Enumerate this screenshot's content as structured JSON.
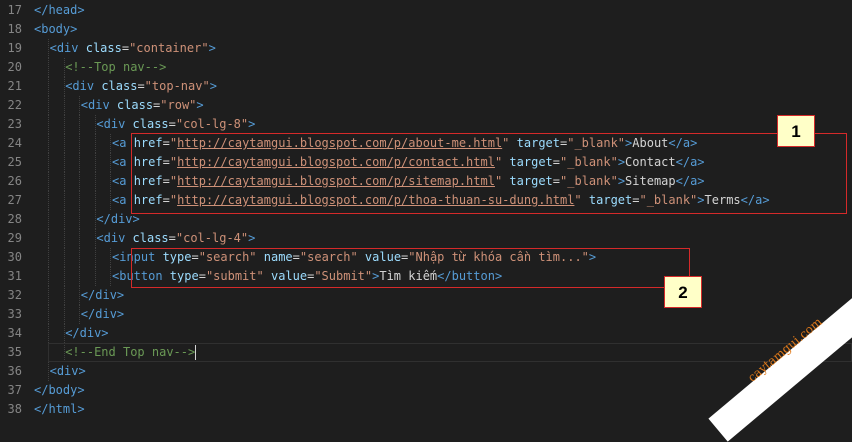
{
  "editor": {
    "lines": [
      {
        "n": "17",
        "indent": 0,
        "tokens": [
          {
            "c": "tag",
            "t": "</head>"
          }
        ]
      },
      {
        "n": "18",
        "indent": 0,
        "tokens": [
          {
            "c": "tag",
            "t": "<body>"
          }
        ]
      },
      {
        "n": "19",
        "indent": 1,
        "tokens": [
          {
            "c": "tag",
            "t": "<div "
          },
          {
            "c": "attr",
            "t": "class"
          },
          {
            "c": "txt",
            "t": "="
          },
          {
            "c": "str",
            "t": "\"container\""
          },
          {
            "c": "tag",
            "t": ">"
          }
        ]
      },
      {
        "n": "20",
        "indent": 2,
        "tokens": [
          {
            "c": "comment",
            "t": "<!--Top nav-->"
          }
        ]
      },
      {
        "n": "21",
        "indent": 2,
        "tokens": [
          {
            "c": "tag",
            "t": "<div "
          },
          {
            "c": "attr",
            "t": "class"
          },
          {
            "c": "txt",
            "t": "="
          },
          {
            "c": "str",
            "t": "\"top-nav\""
          },
          {
            "c": "tag",
            "t": ">"
          }
        ]
      },
      {
        "n": "22",
        "indent": 3,
        "tokens": [
          {
            "c": "tag",
            "t": "<div "
          },
          {
            "c": "attr",
            "t": "class"
          },
          {
            "c": "txt",
            "t": "="
          },
          {
            "c": "str",
            "t": "\"row\""
          },
          {
            "c": "tag",
            "t": ">"
          }
        ]
      },
      {
        "n": "23",
        "indent": 4,
        "tokens": [
          {
            "c": "tag",
            "t": "<div "
          },
          {
            "c": "attr",
            "t": "class"
          },
          {
            "c": "txt",
            "t": "="
          },
          {
            "c": "str",
            "t": "\"col-lg-8\""
          },
          {
            "c": "tag",
            "t": ">"
          }
        ]
      },
      {
        "n": "24",
        "indent": 5,
        "tokens": [
          {
            "c": "tag",
            "t": "<a "
          },
          {
            "c": "attr",
            "t": "href"
          },
          {
            "c": "txt",
            "t": "="
          },
          {
            "c": "str",
            "t": "\""
          },
          {
            "c": "link",
            "t": "http://caytamgui.blogspot.com/p/about-me.html"
          },
          {
            "c": "str",
            "t": "\""
          },
          {
            "c": "txt",
            "t": " "
          },
          {
            "c": "attr",
            "t": "target"
          },
          {
            "c": "txt",
            "t": "="
          },
          {
            "c": "str",
            "t": "\"_blank\""
          },
          {
            "c": "tag",
            "t": ">"
          },
          {
            "c": "txt",
            "t": "About"
          },
          {
            "c": "tag",
            "t": "</a>"
          }
        ]
      },
      {
        "n": "25",
        "indent": 5,
        "tokens": [
          {
            "c": "tag",
            "t": "<a "
          },
          {
            "c": "attr",
            "t": "href"
          },
          {
            "c": "txt",
            "t": "="
          },
          {
            "c": "str",
            "t": "\""
          },
          {
            "c": "link",
            "t": "http://caytamgui.blogspot.com/p/contact.html"
          },
          {
            "c": "str",
            "t": "\""
          },
          {
            "c": "txt",
            "t": " "
          },
          {
            "c": "attr",
            "t": "target"
          },
          {
            "c": "txt",
            "t": "="
          },
          {
            "c": "str",
            "t": "\"_blank\""
          },
          {
            "c": "tag",
            "t": ">"
          },
          {
            "c": "txt",
            "t": "Contact"
          },
          {
            "c": "tag",
            "t": "</a>"
          }
        ]
      },
      {
        "n": "26",
        "indent": 5,
        "tokens": [
          {
            "c": "tag",
            "t": "<a "
          },
          {
            "c": "attr",
            "t": "href"
          },
          {
            "c": "txt",
            "t": "="
          },
          {
            "c": "str",
            "t": "\""
          },
          {
            "c": "link",
            "t": "http://caytamgui.blogspot.com/p/sitemap.html"
          },
          {
            "c": "str",
            "t": "\""
          },
          {
            "c": "txt",
            "t": " "
          },
          {
            "c": "attr",
            "t": "target"
          },
          {
            "c": "txt",
            "t": "="
          },
          {
            "c": "str",
            "t": "\"_blank\""
          },
          {
            "c": "tag",
            "t": ">"
          },
          {
            "c": "txt",
            "t": "Sitemap"
          },
          {
            "c": "tag",
            "t": "</a>"
          }
        ]
      },
      {
        "n": "27",
        "indent": 5,
        "tokens": [
          {
            "c": "tag",
            "t": "<a "
          },
          {
            "c": "attr",
            "t": "href"
          },
          {
            "c": "txt",
            "t": "="
          },
          {
            "c": "str",
            "t": "\""
          },
          {
            "c": "link",
            "t": "http://caytamgui.blogspot.com/p/thoa-thuan-su-dung.html"
          },
          {
            "c": "str",
            "t": "\""
          },
          {
            "c": "txt",
            "t": " "
          },
          {
            "c": "attr",
            "t": "target"
          },
          {
            "c": "txt",
            "t": "="
          },
          {
            "c": "str",
            "t": "\"_blank\""
          },
          {
            "c": "tag",
            "t": ">"
          },
          {
            "c": "txt",
            "t": "Terms"
          },
          {
            "c": "tag",
            "t": "</a>"
          }
        ]
      },
      {
        "n": "28",
        "indent": 4,
        "tokens": [
          {
            "c": "tag",
            "t": "</div>"
          }
        ]
      },
      {
        "n": "29",
        "indent": 4,
        "tokens": [
          {
            "c": "tag",
            "t": "<div "
          },
          {
            "c": "attr",
            "t": "class"
          },
          {
            "c": "txt",
            "t": "="
          },
          {
            "c": "str",
            "t": "\"col-lg-4\""
          },
          {
            "c": "tag",
            "t": ">"
          }
        ]
      },
      {
        "n": "30",
        "indent": 5,
        "tokens": [
          {
            "c": "tag",
            "t": "<input "
          },
          {
            "c": "attr",
            "t": "type"
          },
          {
            "c": "txt",
            "t": "="
          },
          {
            "c": "str",
            "t": "\"search\""
          },
          {
            "c": "txt",
            "t": " "
          },
          {
            "c": "attr",
            "t": "name"
          },
          {
            "c": "txt",
            "t": "="
          },
          {
            "c": "str",
            "t": "\"search\""
          },
          {
            "c": "txt",
            "t": " "
          },
          {
            "c": "attr",
            "t": "value"
          },
          {
            "c": "txt",
            "t": "="
          },
          {
            "c": "str",
            "t": "\"Nhập từ khóa cần tìm...\""
          },
          {
            "c": "tag",
            "t": ">"
          }
        ]
      },
      {
        "n": "31",
        "indent": 5,
        "tokens": [
          {
            "c": "tag",
            "t": "<button "
          },
          {
            "c": "attr",
            "t": "type"
          },
          {
            "c": "txt",
            "t": "="
          },
          {
            "c": "str",
            "t": "\"submit\""
          },
          {
            "c": "txt",
            "t": " "
          },
          {
            "c": "attr",
            "t": "value"
          },
          {
            "c": "txt",
            "t": "="
          },
          {
            "c": "str",
            "t": "\"Submit\""
          },
          {
            "c": "tag",
            "t": ">"
          },
          {
            "c": "txt",
            "t": "Tìm kiếm"
          },
          {
            "c": "tag",
            "t": "</button>"
          }
        ]
      },
      {
        "n": "32",
        "indent": 3,
        "tokens": [
          {
            "c": "tag",
            "t": "</div>"
          }
        ]
      },
      {
        "n": "33",
        "indent": 3,
        "tokens": [
          {
            "c": "tag",
            "t": "</div>"
          }
        ]
      },
      {
        "n": "34",
        "indent": 2,
        "tokens": [
          {
            "c": "tag",
            "t": "</div>"
          }
        ]
      },
      {
        "n": "35",
        "indent": 2,
        "cursor": true,
        "tokens": [
          {
            "c": "comment",
            "t": "<!--End Top nav-->"
          }
        ]
      },
      {
        "n": "36",
        "indent": 1,
        "tokens": [
          {
            "c": "tag",
            "t": "<div>"
          }
        ]
      },
      {
        "n": "37",
        "indent": 0,
        "tokens": [
          {
            "c": "tag",
            "t": "</body>"
          }
        ]
      },
      {
        "n": "38",
        "indent": 0,
        "tokens": [
          {
            "c": "tag",
            "t": "</html>"
          }
        ]
      }
    ]
  },
  "annotations": {
    "badge1": "1",
    "badge2": "2"
  },
  "watermark": "caytamgui.com",
  "colors": {
    "background": "#1e1e1e",
    "tag": "#569cd6",
    "attribute": "#9cdcfe",
    "string": "#ce9178",
    "comment": "#6a9955",
    "highlight_box": "#d52a2a",
    "badge_fill": "#ffffc8",
    "watermark_text": "#e07a1a"
  }
}
